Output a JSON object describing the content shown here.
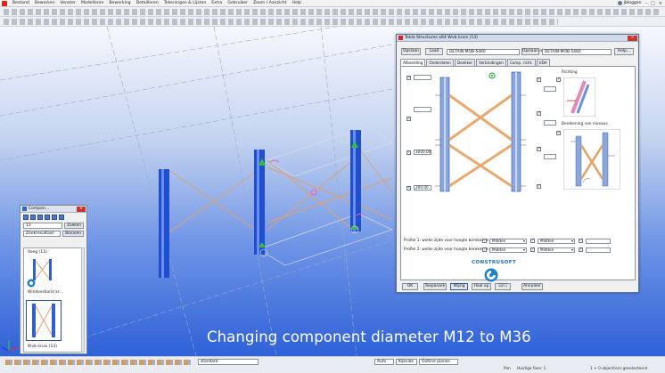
{
  "menubar": {
    "items": [
      "Bestand",
      "Bewerken",
      "Venster",
      "Modelleren",
      "Bewerking",
      "Detailleren",
      "Tekeningen & Lijsten",
      "Extra",
      "Gebruiker",
      "Zoom / Aanzicht",
      "Help"
    ],
    "user": "jbloggen"
  },
  "component_panel": {
    "title": "Compon...",
    "search_value": "13",
    "search_button": "Zoeken",
    "result_select": "Zoekresultaat",
    "back_button": "Bovaren",
    "items": [
      {
        "label": "Voeg (13)"
      },
      {
        "label": "Windverband kr..."
      },
      {
        "label": "Wvb kruis (13)"
      }
    ]
  },
  "dialog": {
    "title": "Tekla Structures x64  Wvb kruis (13)",
    "top": {
      "save_button": "Opslaan",
      "load_button": "Laad",
      "preset_value": "DETAIN-MOB-5460",
      "save_as_button": "Opslaan al",
      "save_as_value": "DETAIN-MOB-5460",
      "help_button": "Help..."
    },
    "tabs": [
      "Afbeelding",
      "Onderdelen",
      "Doekker",
      "Verbindingen",
      "Comp. richt.",
      "UDA"
    ],
    "fields": {
      "dim_1": "3000.00",
      "dim_2": "200.00"
    },
    "labels": {
      "richting": "Richting",
      "berekening": "Berekening van niveaus"
    },
    "profile_rows": [
      {
        "label": "Profiel 1: welke zijde voor hoogte berekenen",
        "sel1": "Midden",
        "sel2": "Midden"
      },
      {
        "label": "Profiel 2: welke zijde voor hoogte berekenen",
        "sel1": "Midden",
        "sel2": "Midden"
      }
    ],
    "logo_text": "CONSTRUSOFT",
    "bottom": {
      "ok": "OK",
      "apply": "Toepassen",
      "modify": "Wijzig",
      "get": "Haal op",
      "toggle": "☑/☐",
      "cancel": "Annuleer"
    }
  },
  "statusbar": {
    "select_1": "standard",
    "select_2": "Auto",
    "select_3": "Kijkvlak",
    "select_4": "Outline planes",
    "text_1": "Pan",
    "text_2": "Huidige fase: 1",
    "text_3": "1 + 0 object(en) geselecteerd"
  },
  "caption": "Changing component diameter M12 to M36"
}
